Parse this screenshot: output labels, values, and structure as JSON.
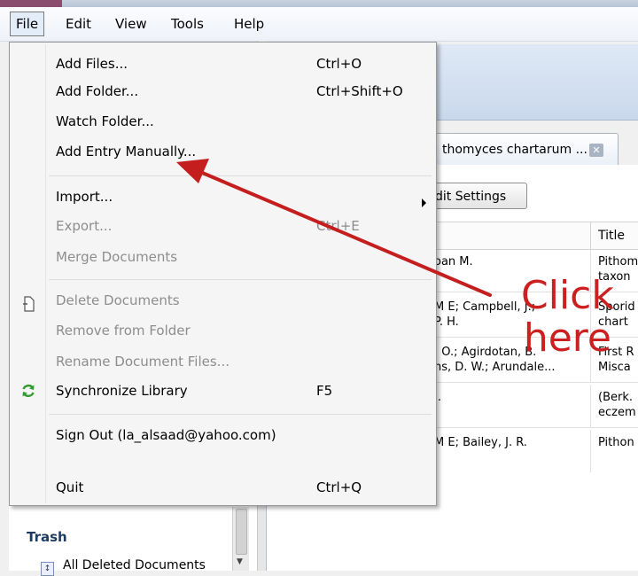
{
  "menubar": {
    "items": [
      "File",
      "Edit",
      "View",
      "Tools",
      "Help"
    ]
  },
  "file_menu": {
    "add_files": {
      "label": "Add Files...",
      "shortcut": "Ctrl+O"
    },
    "add_folder": {
      "label": "Add Folder...",
      "shortcut": "Ctrl+Shift+O"
    },
    "watch_folder": {
      "label": "Watch Folder..."
    },
    "add_entry": {
      "label": "Add Entry Manually..."
    },
    "import": {
      "label": "Import..."
    },
    "export": {
      "label": "Export...",
      "shortcut": "Ctrl+E"
    },
    "merge": {
      "label": "Merge Documents"
    },
    "delete": {
      "label": "Delete Documents"
    },
    "remove": {
      "label": "Remove from Folder"
    },
    "rename": {
      "label": "Rename Document Files..."
    },
    "sync": {
      "label": "Synchronize Library",
      "shortcut": "F5"
    },
    "sign_out": {
      "label": "Sign Out (la_alsaad@yahoo.com)"
    },
    "quit": {
      "label": "Quit",
      "shortcut": "Ctrl+Q"
    }
  },
  "document_tab": {
    "label": "thomyces chartarum ...",
    "close": "✕"
  },
  "edit_settings": {
    "label": "dit Settings"
  },
  "table": {
    "title_header": "Title",
    "rows": [
      {
        "authors": "oan M.",
        "title": "Pithom\ntaxon"
      },
      {
        "authors": "M E; Campbell, J.;\nP. H.",
        "title": "Sporid\nchart"
      },
      {
        "authors": ". O.; Agirdotan, B.\nns, D. W.; Arundale...",
        "title": "First R\nMisca"
      },
      {
        "authors": "J.",
        "title": "(Berk.\neczem"
      },
      {
        "authors": "M E; Bailey, J. R.",
        "title": "Pithon"
      }
    ]
  },
  "sidebar": {
    "trash": "Trash",
    "deleted": "All Deleted Documents"
  },
  "annotation": {
    "text_line1": "Click",
    "text_line2": "here",
    "color": "#cc1f1f"
  }
}
